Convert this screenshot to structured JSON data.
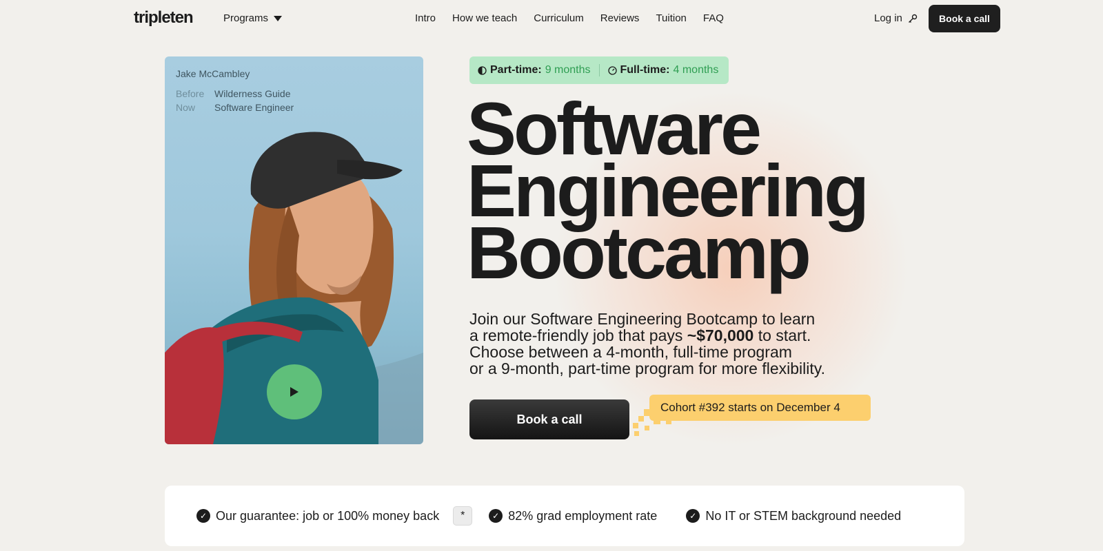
{
  "header": {
    "logo": "tripleten",
    "programs_label": "Programs",
    "nav": [
      "Intro",
      "How we teach",
      "Curriculum",
      "Reviews",
      "Tuition",
      "FAQ"
    ],
    "login_label": "Log in",
    "cta_label": "Book a call"
  },
  "video_card": {
    "name": "Jake McCambley",
    "before_key": "Before",
    "before_value": "Wilderness Guide",
    "now_key": "Now",
    "now_value": "Software Engineer"
  },
  "hero": {
    "part_time_label": "Part-time:",
    "part_time_value": "9 months",
    "full_time_label": "Full-time:",
    "full_time_value": "4 months",
    "headline_line1": "Software",
    "headline_line2": "Engineering",
    "headline_line3": "Bootcamp",
    "sub_line1": "Join our Software Engineering Bootcamp to learn",
    "sub_line2a": "a remote-friendly job that pays ",
    "sub_line2_salary": "~$70,000",
    "sub_line2b": " to start.",
    "sub_line3": "Choose between a 4-month, full-time program",
    "sub_line4": "or a 9-month, part-time program for more flexibility.",
    "cta_label": "Book a call",
    "cohort_label": "Cohort #392 starts on December 4"
  },
  "features": {
    "items": [
      "Our guarantee: job or 100% money back",
      "82% grad employment rate",
      "No IT or STEM background needed"
    ],
    "asterisk": "*"
  },
  "colors": {
    "accent_green": "#2f9e53",
    "pill_bg": "#b6e8c6",
    "cohort_bg": "#fccf6e",
    "play_button": "#5fbf7a",
    "dark_button": "#1f1f1f"
  },
  "icons": {
    "caret": "chevron-down-icon",
    "login": "key-icon",
    "part_time": "half-clock-icon",
    "full_time": "clock-icon",
    "play": "play-icon",
    "check": "check-circle-icon"
  }
}
